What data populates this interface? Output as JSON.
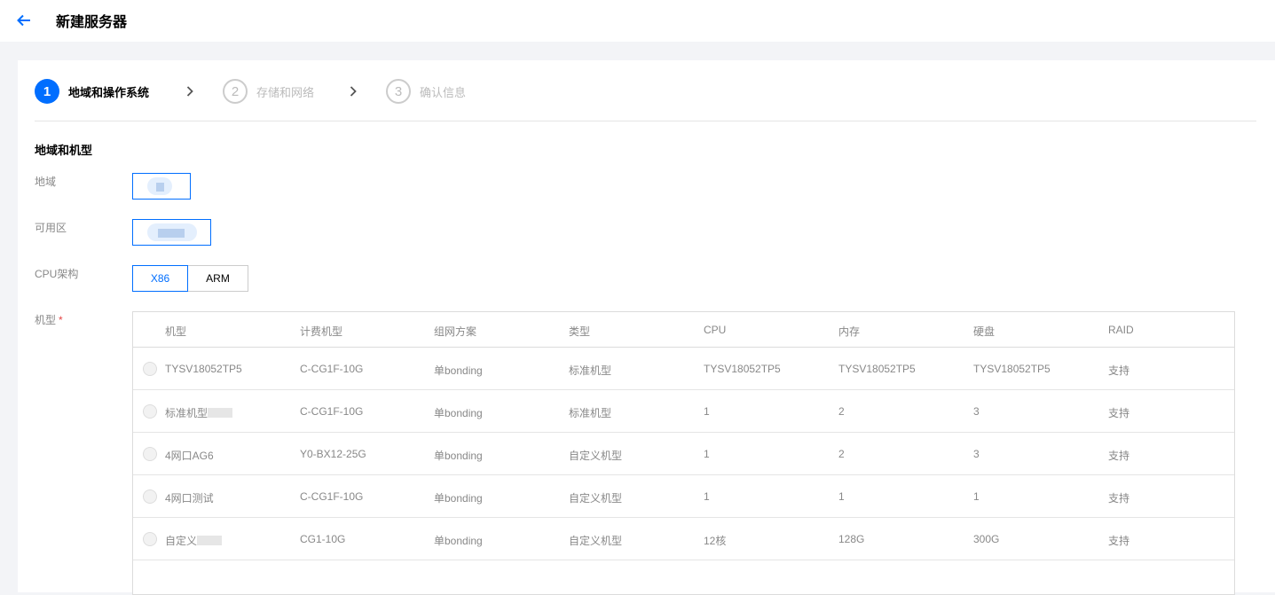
{
  "header": {
    "title": "新建服务器"
  },
  "steps": [
    {
      "num": "1",
      "label": "地域和操作系统"
    },
    {
      "num": "2",
      "label": "存储和网络"
    },
    {
      "num": "3",
      "label": "确认信息"
    }
  ],
  "section": {
    "title": "地域和机型"
  },
  "form": {
    "region_label": "地域",
    "zone_label": "可用区",
    "cpu_arch_label": "CPU架构",
    "cpu_arch_options": [
      "X86",
      "ARM"
    ],
    "cpu_arch_selected": "X86",
    "model_label": "机型",
    "required_mark": "*"
  },
  "table": {
    "headers": [
      "机型",
      "计费机型",
      "组网方案",
      "类型",
      "CPU",
      "内存",
      "硬盘",
      "RAID"
    ],
    "rows": [
      [
        "TYSV18052TP5",
        "C-CG1F-10G",
        "单bonding",
        "标准机型",
        "TYSV18052TP5",
        "TYSV18052TP5",
        "TYSV18052TP5",
        "支持"
      ],
      [
        "标准机型",
        "C-CG1F-10G",
        "单bonding",
        "标准机型",
        "1",
        "2",
        "3",
        "支持"
      ],
      [
        "4网口AG6",
        "Y0-BX12-25G",
        "单bonding",
        "自定义机型",
        "1",
        "2",
        "3",
        "支持"
      ],
      [
        "4网口测试",
        "C-CG1F-10G",
        "单bonding",
        "自定义机型",
        "1",
        "1",
        "1",
        "支持"
      ],
      [
        "自定义",
        "CG1-10G",
        "单bonding",
        "自定义机型",
        "12核",
        "128G",
        "300G",
        "支持"
      ]
    ]
  }
}
